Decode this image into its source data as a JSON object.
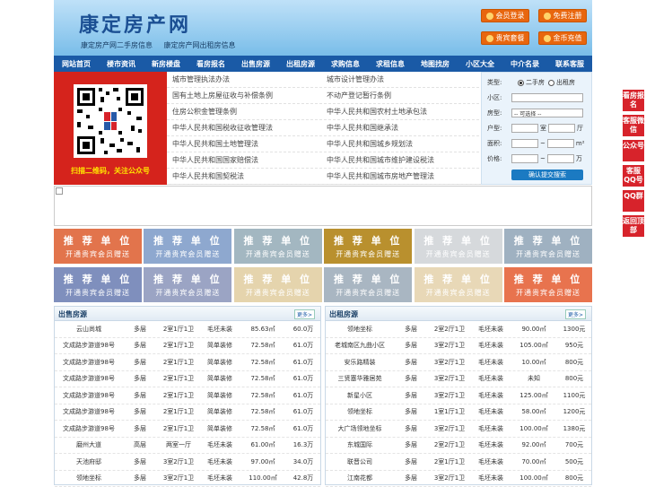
{
  "header": {
    "title": "康定房产网",
    "sub": [
      "康定房产网二手房信息",
      "康定房产网出租房信息"
    ],
    "buttons": [
      "会员登录",
      "免费注册",
      "贵宾套餐",
      "金币充值"
    ]
  },
  "nav": [
    "网站首页",
    "楼市资讯",
    "新房楼盘",
    "看房报名",
    "出售房源",
    "出租房源",
    "求购信息",
    "求租信息",
    "地图找房",
    "小区大全",
    "中介名录",
    "联系客服"
  ],
  "qr_caption": "扫描二维码，关注公众号",
  "links": [
    [
      "城市管理执法办法",
      "城市设计管理办法"
    ],
    [
      "国有土地上房屋征收与补偿条例",
      "不动产登记暂行条例"
    ],
    [
      "住房公积金管理条例",
      "中华人民共和国农村土地承包法"
    ],
    [
      "中华人民共和国税收征收管理法",
      "中华人民共和国继承法"
    ],
    [
      "中华人民共和国土地管理法",
      "中华人民共和国城乡规划法"
    ],
    [
      "中华人民共和国国家赔偿法",
      "中华人民共和国城市维护建设税法"
    ],
    [
      "中华人民共和国契税法",
      "中华人民共和国城市房地产管理法"
    ]
  ],
  "search": {
    "type_label": "类型:",
    "type_options": [
      "二手房",
      "出租房"
    ],
    "community_label": "小区:",
    "housetype_label": "房型:",
    "housetype_select": "-- 可选择 --",
    "layout_label": "户型:",
    "room_unit": "室",
    "hall_unit": "厅",
    "area_label": "面积:",
    "area_unit": "m²",
    "price_label": "价格:",
    "price_unit": "万",
    "tilde": "~",
    "submit": "确认提交搜索"
  },
  "ads": {
    "title": "推 荐 单 位",
    "subtitle": "开通贵宾会员赠送",
    "colors": [
      "#e2744c",
      "#8ea8cf",
      "#a3b7c1",
      "#b9902e",
      "#d6d9dc",
      "#9fb1c1",
      "#7f8fbd",
      "#9ba4c4",
      "#e5d4ad",
      "#a9b6c2",
      "#e8d8b7",
      "#e8734e"
    ]
  },
  "sale": {
    "title": "出售房源",
    "more": "更多>",
    "rows": [
      [
        "云山尚城",
        "多层",
        "2室1厅1卫",
        "毛坯未装",
        "85.63㎡",
        "60.0万"
      ],
      [
        "文成路步游道98号",
        "多层",
        "2室1厅1卫",
        "简单装修",
        "72.58㎡",
        "61.0万"
      ],
      [
        "文成路步游道98号",
        "多层",
        "2室1厅1卫",
        "简单装修",
        "72.58㎡",
        "61.0万"
      ],
      [
        "文成路步游道98号",
        "多层",
        "2室1厅1卫",
        "简单装修",
        "72.58㎡",
        "61.0万"
      ],
      [
        "文成路步游道98号",
        "多层",
        "2室1厅1卫",
        "简单装修",
        "72.58㎡",
        "61.0万"
      ],
      [
        "文成路步游道98号",
        "多层",
        "2室1厅1卫",
        "简单装修",
        "72.58㎡",
        "61.0万"
      ],
      [
        "文成路步游道98号",
        "多层",
        "2室1厅1卫",
        "简单装修",
        "72.58㎡",
        "61.0万"
      ],
      [
        "磨州大道",
        "高层",
        "两室一厅",
        "毛坯未装",
        "61.00㎡",
        "16.3万"
      ],
      [
        "天池府邸",
        "多层",
        "3室2厅1卫",
        "毛坯未装",
        "97.00㎡",
        "34.0万"
      ],
      [
        "领地坐标",
        "多层",
        "3室2厅1卫",
        "毛坯未装",
        "110.00㎡",
        "42.8万"
      ]
    ]
  },
  "rent": {
    "title": "出租房源",
    "more": "更多>",
    "rows": [
      [
        "领地坐标",
        "多层",
        "2室2厅1卫",
        "毛坯未装",
        "90.00㎡",
        "1300元"
      ],
      [
        "老城南区九曲小区",
        "多层",
        "3室2厅1卫",
        "毛坯未装",
        "105.00㎡",
        "950元"
      ],
      [
        "安乐路精装",
        "多层",
        "3室2厅1卫",
        "毛坯未装",
        "10.00㎡",
        "800元"
      ],
      [
        "三贤塞华雅居苑",
        "多层",
        "3室2厅1卫",
        "毛坯未装",
        "未知",
        "800元"
      ],
      [
        "新星小区",
        "多层",
        "3室2厅1卫",
        "毛坯未装",
        "125.00㎡",
        "1100元"
      ],
      [
        "领地坐标",
        "多层",
        "1室1厅1卫",
        "毛坯未装",
        "58.00㎡",
        "1200元"
      ],
      [
        "大广场领地坐标",
        "多层",
        "3室2厅1卫",
        "毛坯未装",
        "100.00㎡",
        "1380元"
      ],
      [
        "东城国际",
        "多层",
        "2室2厅1卫",
        "毛坯未装",
        "92.00㎡",
        "700元"
      ],
      [
        "联晋公司",
        "多层",
        "2室1厅1卫",
        "毛坯未装",
        "70.00㎡",
        "500元"
      ],
      [
        "江南花都",
        "多层",
        "3室2厅1卫",
        "毛坯未装",
        "100.00㎡",
        "800元"
      ]
    ]
  },
  "side": [
    "看房报名",
    "客服微信",
    "公众号",
    "客服QQ号",
    "QQ群",
    "返回顶部"
  ]
}
